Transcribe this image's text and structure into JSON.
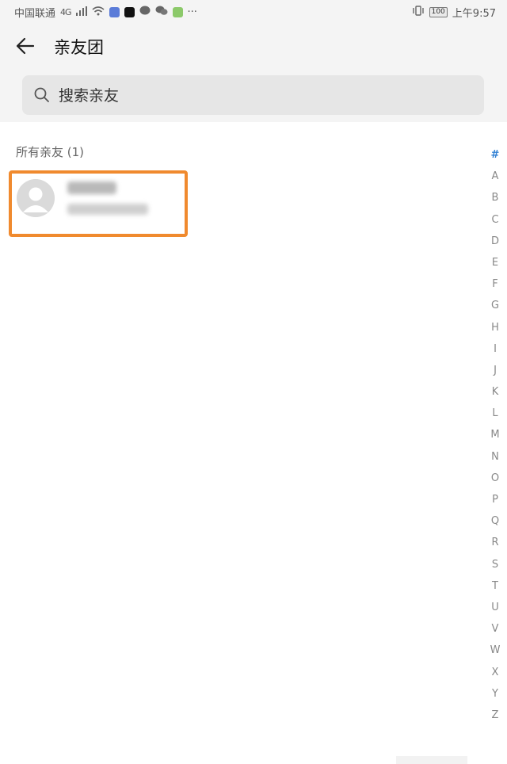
{
  "status_bar": {
    "carrier": "中国联通",
    "network": "4G",
    "more": "···",
    "battery": "100",
    "time": "上午9:57"
  },
  "header": {
    "title": "亲友团",
    "back_icon": "arrow-left-icon"
  },
  "search": {
    "placeholder": "搜索亲友",
    "value": ""
  },
  "list": {
    "section_title": "所有亲友 (1)",
    "contacts": [
      {
        "name_visible": false,
        "highlight_color": "#f08a2e"
      }
    ]
  },
  "index": [
    "#",
    "A",
    "B",
    "C",
    "D",
    "E",
    "F",
    "G",
    "H",
    "I",
    "J",
    "K",
    "L",
    "M",
    "N",
    "O",
    "P",
    "Q",
    "R",
    "S",
    "T",
    "U",
    "V",
    "W",
    "X",
    "Y",
    "Z"
  ],
  "colors": {
    "accent": "#2f7fd3",
    "highlight": "#f08a2e",
    "bar_bg": "#f4f4f4",
    "search_bg": "#e6e6e6"
  }
}
